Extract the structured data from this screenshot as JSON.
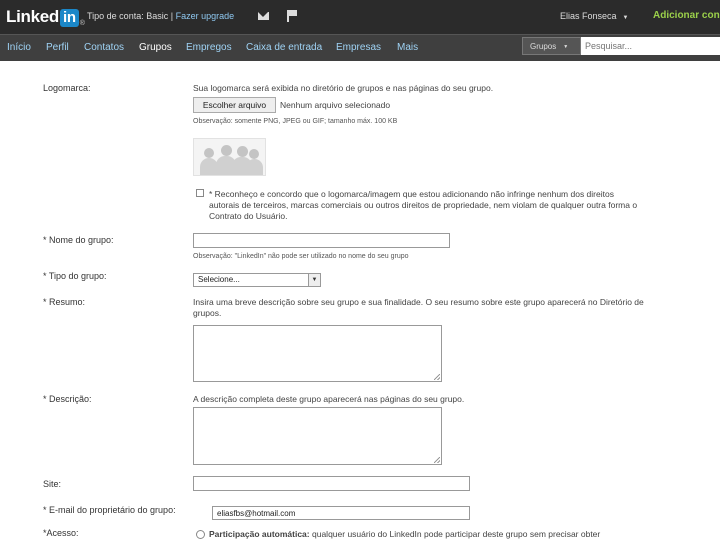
{
  "topbar": {
    "logo_text": "Linked",
    "logo_in": "in",
    "logo_reg": "®",
    "account_type": "Tipo de conta: Basic",
    "separator": "|",
    "upgrade": "Fazer upgrade",
    "user_name": "Elias Fonseca",
    "user_caret": "▼",
    "add_contacts": "Adicionar con"
  },
  "nav": {
    "items": [
      "Início",
      "Perfil",
      "Contatos",
      "Grupos",
      "Empregos",
      "Caixa de entrada",
      "Empresas",
      "Mais"
    ],
    "active": "Grupos",
    "search_scope": "Grupos",
    "search_caret": "▼",
    "search_placeholder": "Pesquisar..."
  },
  "form": {
    "logo_label": "Logomarca:",
    "logo_hint": "Sua logomarca será exibida no diretório de grupos e nas páginas do seu grupo.",
    "choose_file": "Escolher arquivo",
    "no_file": "Nenhum arquivo selecionado",
    "file_note": "Observação: somente PNG, JPEG ou GIF; tamanho máx. 100 KB",
    "ack_line1": "* Reconheço e concordo que o logomarca/imagem que estou adicionando não infringe nenhum dos direitos",
    "ack_line2": "autorais de terceiros, marcas comerciais ou outros direitos de propriedade, nem violam de qualquer outra forma o",
    "ack_line3": "Contrato do Usuário.",
    "name_label": "* Nome do grupo:",
    "name_note": "Observação: \"LinkedIn\" não pode ser utilizado no nome do seu grupo",
    "type_label": "* Tipo do grupo:",
    "type_selected": "Selecione...",
    "type_arrow": "▼",
    "summary_label": "* Resumo:",
    "summary_hint_line1": "Insira uma breve descrição sobre seu grupo e sua finalidade. O seu resumo sobre este grupo aparecerá no Diretório de",
    "summary_hint_line2": "grupos.",
    "description_label": "* Descrição:",
    "description_hint": "A descrição completa deste grupo aparecerá nas páginas do seu grupo.",
    "site_label": "Site:",
    "owner_email_label": "* E-mail do proprietário do grupo:",
    "owner_email_value": "eliasfbs@hotmail.com",
    "access_label": "*Acesso:",
    "access_option_bold": "Participação automática:",
    "access_option_text": "qualquer usuário do LinkedIn pode participar deste grupo sem precisar obter"
  }
}
